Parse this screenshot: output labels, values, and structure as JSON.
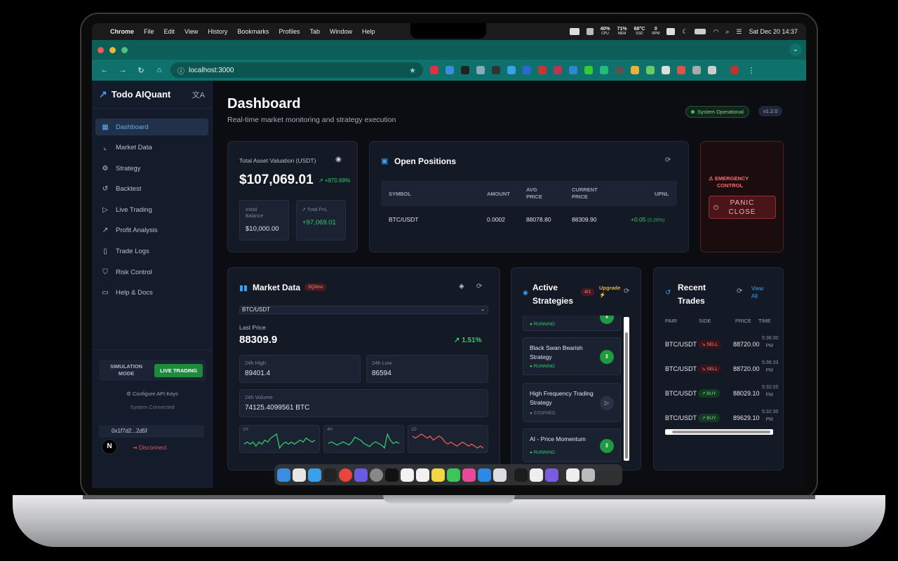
{
  "menubar": {
    "app": "Chrome",
    "menus": [
      "File",
      "Edit",
      "View",
      "History",
      "Bookmarks",
      "Profiles",
      "Tab",
      "Window",
      "Help"
    ],
    "stats": [
      {
        "v": "40%",
        "k": "CPU"
      },
      {
        "v": "71%",
        "k": "MEM"
      },
      {
        "v": "68°C",
        "k": "SSD"
      },
      {
        "v": "0",
        "k": "RPM"
      }
    ],
    "datetime": "Sat Dec 20  14:37"
  },
  "browser": {
    "url": "localhost:3000"
  },
  "sidebar": {
    "brand": "Todo AIQuant",
    "items": [
      {
        "label": "Dashboard",
        "icon": "grid-icon"
      },
      {
        "label": "Market Data",
        "icon": "chart-icon"
      },
      {
        "label": "Strategy",
        "icon": "gear-icon"
      },
      {
        "label": "Backtest",
        "icon": "history-icon"
      },
      {
        "label": "Live Trading",
        "icon": "play-icon"
      },
      {
        "label": "Profit Analysis",
        "icon": "trend-icon"
      },
      {
        "label": "Trade Logs",
        "icon": "book-icon"
      },
      {
        "label": "Risk Control",
        "icon": "shield-icon"
      },
      {
        "label": "Help & Docs",
        "icon": "book-open-icon"
      }
    ],
    "mode_label_1": "SIMULATION",
    "mode_label_2": "MODE",
    "live_button": "LIVE TRADING",
    "configure": "⚙ Configure API Keys",
    "system_status": "System Connected",
    "wallet": "0x1f7d2...2d5f",
    "disconnect": "Disconnect",
    "avatar": "N"
  },
  "header": {
    "title": "Dashboard",
    "subtitle": "Real-time market monitoring and strategy execution",
    "status": "System Operational",
    "version": "v1.2.0"
  },
  "asset": {
    "label": "Total Asset Valuation (USDT)",
    "value": "$107,069.01",
    "change": "↗ +970.69%",
    "initial_label_1": "Initial",
    "initial_label_2": "Balance",
    "initial_value": "$10,000.00",
    "pnl_label": "↗ Total PnL",
    "pnl_value": "+97,069.01"
  },
  "positions": {
    "title": "Open Positions",
    "headers": {
      "symbol": "SYMBOL",
      "amount": "AMOUNT",
      "avg1": "AVG",
      "avg2": "PRICE",
      "cur1": "CURRENT",
      "cur2": "PRICE",
      "upnl": "UPNL"
    },
    "row": {
      "symbol": "BTC/USDT",
      "amount": "0.0002",
      "avg": "88078.80",
      "current": "88309.90",
      "upnl": "+0.05",
      "pct": "(0.26%)"
    }
  },
  "emergency": {
    "label_1": "EMERGENCY",
    "label_2": "CONTROL",
    "btn_1": "PANIC",
    "btn_2": "CLOSE"
  },
  "market": {
    "title": "Market Data",
    "badge": "3Q3ms",
    "symbol": "BTC/USDT",
    "last_label": "Last Price",
    "last_price": "88309.9",
    "change": "↗ 1.51%",
    "high_label": "24h High",
    "high": "89401.4",
    "low_label": "24h Low",
    "low": "86594",
    "vol_label": "24h Volume",
    "volume": "74125.4099561 BTC",
    "spark": [
      {
        "label": "1H",
        "color": "#2ecc6a",
        "values": [
          5,
          6,
          5,
          6,
          4,
          6,
          5,
          7,
          6,
          8,
          9,
          10,
          3,
          5,
          6,
          5,
          6,
          5,
          6,
          7,
          6,
          8,
          7,
          6,
          7
        ]
      },
      {
        "label": "4H",
        "color": "#2ecc6a",
        "values": [
          6,
          7,
          6,
          5,
          6,
          7,
          6,
          5,
          7,
          10,
          9,
          8,
          6,
          5,
          4,
          6,
          7,
          6,
          5,
          3,
          12,
          8,
          6,
          7,
          6
        ]
      },
      {
        "label": "1D",
        "color": "#ef5a4a",
        "values": [
          9,
          8,
          9,
          10,
          9,
          8,
          9,
          7,
          8,
          9,
          8,
          6,
          5,
          6,
          5,
          4,
          5,
          6,
          5,
          4,
          5,
          4,
          3,
          4,
          3
        ]
      }
    ]
  },
  "strategies": {
    "title_1": "Active",
    "title_2": "Strategies",
    "count": "4/1",
    "upgrade": "Upgrade ⚡",
    "items": [
      {
        "name": "",
        "status": "RUNNING",
        "running": true
      },
      {
        "name": "Black Swan Bearish Strategy",
        "status": "RUNNING",
        "running": true
      },
      {
        "name": "High Frequency Trading Strategy",
        "status": "STOPPED",
        "running": false
      },
      {
        "name": "AI - Price Momentum",
        "status": "RUNNING",
        "running": true
      }
    ]
  },
  "trades": {
    "title_1": "Recent",
    "title_2": "Trades",
    "view_all_1": "View",
    "view_all_2": "All",
    "headers": {
      "pair": "PAIR",
      "side": "SIDE",
      "price": "PRICE",
      "time": "TIME"
    },
    "rows": [
      {
        "pair": "BTC/USDT",
        "side": "↘ SELL",
        "price": "88720.00",
        "t1": "5:36:30",
        "t2": "PM",
        "sell": true
      },
      {
        "pair": "BTC/USDT",
        "side": "↘ SELL",
        "price": "88720.00",
        "t1": "5:36:33",
        "t2": "PM",
        "sell": true
      },
      {
        "pair": "BTC/USDT",
        "side": "↗ BUY",
        "price": "88029.10",
        "t1": "5:32:20",
        "t2": "PM",
        "sell": false
      },
      {
        "pair": "BTC/USDT",
        "side": "↗ BUY",
        "price": "89629.10",
        "t1": "5:32:30",
        "t2": "PM",
        "sell": false
      }
    ]
  }
}
